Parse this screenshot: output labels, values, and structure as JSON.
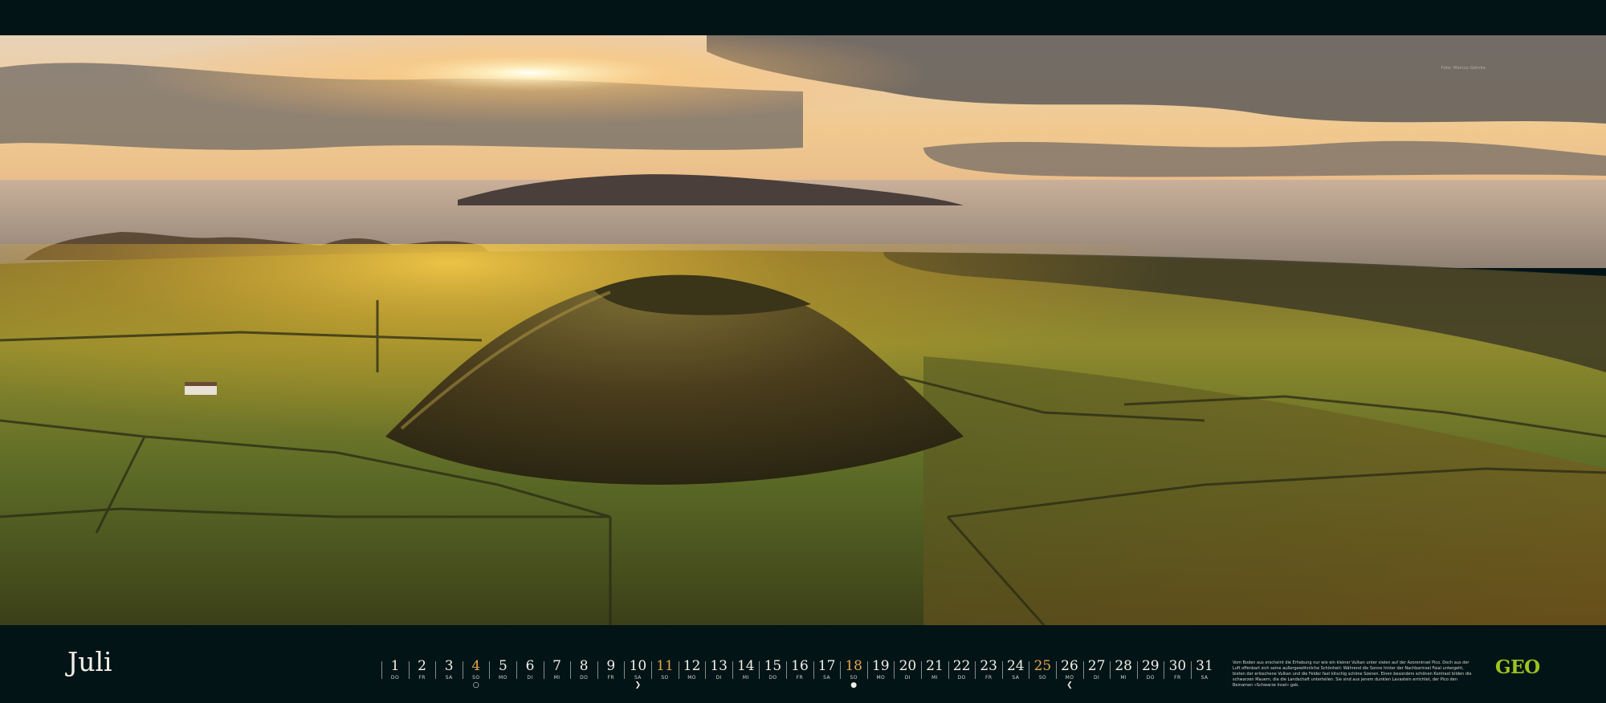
{
  "photo": {
    "credit": "Foto: Marcus Gehrke",
    "subject": "landscape-photo"
  },
  "month": "Juli",
  "days": [
    {
      "n": "1",
      "wd": "DO"
    },
    {
      "n": "2",
      "wd": "FR"
    },
    {
      "n": "3",
      "wd": "SA"
    },
    {
      "n": "4",
      "wd": "SO",
      "weekend": true,
      "mark": "○"
    },
    {
      "n": "5",
      "wd": "MO"
    },
    {
      "n": "6",
      "wd": "DI"
    },
    {
      "n": "7",
      "wd": "MI"
    },
    {
      "n": "8",
      "wd": "DO"
    },
    {
      "n": "9",
      "wd": "FR"
    },
    {
      "n": "10",
      "wd": "SA",
      "mark": "❯"
    },
    {
      "n": "11",
      "wd": "SO",
      "weekend": true
    },
    {
      "n": "12",
      "wd": "MO"
    },
    {
      "n": "13",
      "wd": "DI"
    },
    {
      "n": "14",
      "wd": "MI"
    },
    {
      "n": "15",
      "wd": "DO"
    },
    {
      "n": "16",
      "wd": "FR"
    },
    {
      "n": "17",
      "wd": "SA"
    },
    {
      "n": "18",
      "wd": "SO",
      "weekend": true,
      "mark": "●"
    },
    {
      "n": "19",
      "wd": "MO"
    },
    {
      "n": "20",
      "wd": "DI"
    },
    {
      "n": "21",
      "wd": "MI"
    },
    {
      "n": "22",
      "wd": "DO"
    },
    {
      "n": "23",
      "wd": "FR"
    },
    {
      "n": "24",
      "wd": "SA"
    },
    {
      "n": "25",
      "wd": "SO",
      "weekend": true
    },
    {
      "n": "26",
      "wd": "MO",
      "mark": "❮"
    },
    {
      "n": "27",
      "wd": "DI"
    },
    {
      "n": "28",
      "wd": "MI"
    },
    {
      "n": "29",
      "wd": "DO"
    },
    {
      "n": "30",
      "wd": "FR"
    },
    {
      "n": "31",
      "wd": "SA"
    }
  ],
  "description": "Vom Boden aus erscheint die Erhebung nur wie ein kleiner Vulkan unter vielen auf der Azoreninsel Pico. Doch aus der Luft offenbart sich seine außergewöhnliche Schönheit: Während die Sonne hinter der Nachbarinsel Faial untergeht, bieten der erloschene Vulkan und die Felder fast kitschig schöne Szenen. Einen besonders schönen Kontrast bilden die schwarzen Mauern, die die Landschaft unterteilen. Sie sind aus jenem dunklen Lavastein errichtet, der Pico den Beinamen »Schwarze Insel« gab.",
  "logo": "GEO",
  "colors": {
    "background": "#031417",
    "weekend": "#e2a64f",
    "logo": "#9ec41f",
    "text": "#f2efe6"
  }
}
